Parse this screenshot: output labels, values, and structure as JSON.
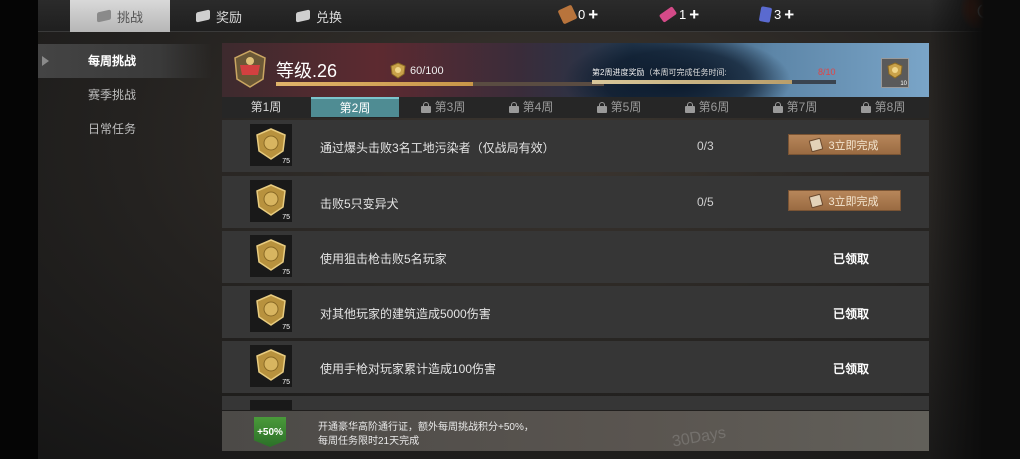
{
  "top_tabs": [
    {
      "label": "挑战",
      "active": true,
      "icon": "challenge-icon"
    },
    {
      "label": "奖励",
      "active": false,
      "icon": "reward-icon"
    },
    {
      "label": "兑换",
      "active": false,
      "icon": "exchange-icon"
    }
  ],
  "resources": [
    {
      "icon": "ticket-icon",
      "value": "0",
      "color": "#b8743c"
    },
    {
      "icon": "pink-ticket-icon",
      "value": "1",
      "color": "#d44a88"
    },
    {
      "icon": "card-icon",
      "value": "3",
      "color": "#5a6ad0"
    }
  ],
  "sidebar": {
    "items": [
      {
        "label": "每周挑战",
        "active": true
      },
      {
        "label": "赛季挑战",
        "active": false
      },
      {
        "label": "日常任务",
        "active": false
      }
    ]
  },
  "header": {
    "level_label": "等级.26",
    "xp_text": "60/100",
    "xp_fraction": 0.6,
    "progress_label": "第2周进度奖励",
    "progress_sub": "（本周可完成任务时间:",
    "progress_count": "8/10",
    "progress_fraction": 0.82,
    "reward_count": "10"
  },
  "weeks": [
    {
      "label": "第1周",
      "locked": false,
      "active": false
    },
    {
      "label": "第2周",
      "locked": false,
      "active": true
    },
    {
      "label": "第3周",
      "locked": true,
      "active": false
    },
    {
      "label": "第4周",
      "locked": true,
      "active": false
    },
    {
      "label": "第5周",
      "locked": true,
      "active": false
    },
    {
      "label": "第6周",
      "locked": true,
      "active": false
    },
    {
      "label": "第7周",
      "locked": true,
      "active": false
    },
    {
      "label": "第8周",
      "locked": true,
      "active": false
    }
  ],
  "tasks": [
    {
      "title": "通过爆头击败3名工地污染者（仅战局有效）",
      "progress": "0/3",
      "points": "75",
      "action": "button",
      "action_label": "3立即完成"
    },
    {
      "title": "击败5只变异犬",
      "progress": "0/5",
      "points": "75",
      "action": "button",
      "action_label": "3立即完成"
    },
    {
      "title": "使用狙击枪击败5名玩家",
      "progress": "",
      "points": "75",
      "action": "claimed",
      "action_label": "已领取"
    },
    {
      "title": "对其他玩家的建筑造成5000伤害",
      "progress": "",
      "points": "75",
      "action": "claimed",
      "action_label": "已领取"
    },
    {
      "title": "使用手枪对玩家累计造成100伤害",
      "progress": "",
      "points": "75",
      "action": "claimed",
      "action_label": "已领取"
    }
  ],
  "footer": {
    "badge": "+50%",
    "line1": "开通豪华高阶通行证，额外每周挑战积分+50%，",
    "line2": "每周任务限时21天完成",
    "watermark": "30Days"
  },
  "colors": {
    "active_week": "#4f8c93",
    "button": "#a87850",
    "footer_badge": "#3a8a32"
  }
}
